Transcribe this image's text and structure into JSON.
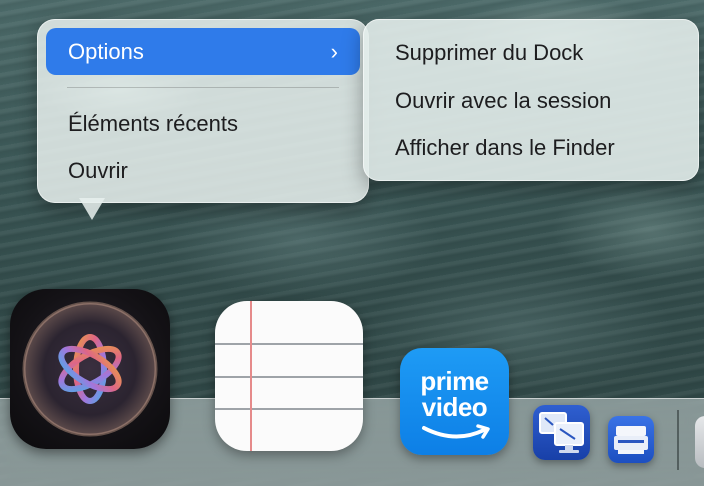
{
  "context_menu": {
    "items": [
      {
        "label": "Options",
        "selected": true,
        "has_submenu": true,
        "chevron": "›"
      },
      {
        "label": "Éléments récents",
        "selected": false
      },
      {
        "label": "Ouvrir",
        "selected": false
      }
    ]
  },
  "submenu": {
    "items": [
      {
        "label": "Supprimer du Dock"
      },
      {
        "label": "Ouvrir avec la session"
      },
      {
        "label": "Afficher dans le Finder"
      }
    ]
  },
  "dock": {
    "apps": [
      {
        "icon": "siri-icon"
      },
      {
        "icon": "notes-icon"
      },
      {
        "icon": "prime-video-icon",
        "text_line1": "prime",
        "text_line2": "video"
      },
      {
        "icon": "screen-sharing-icon"
      },
      {
        "icon": "image-capture-icon"
      },
      {
        "icon": "partial-app-icon"
      }
    ]
  },
  "colors": {
    "selection": "#2f7bea",
    "prime_blue": "#1e9bf5"
  }
}
